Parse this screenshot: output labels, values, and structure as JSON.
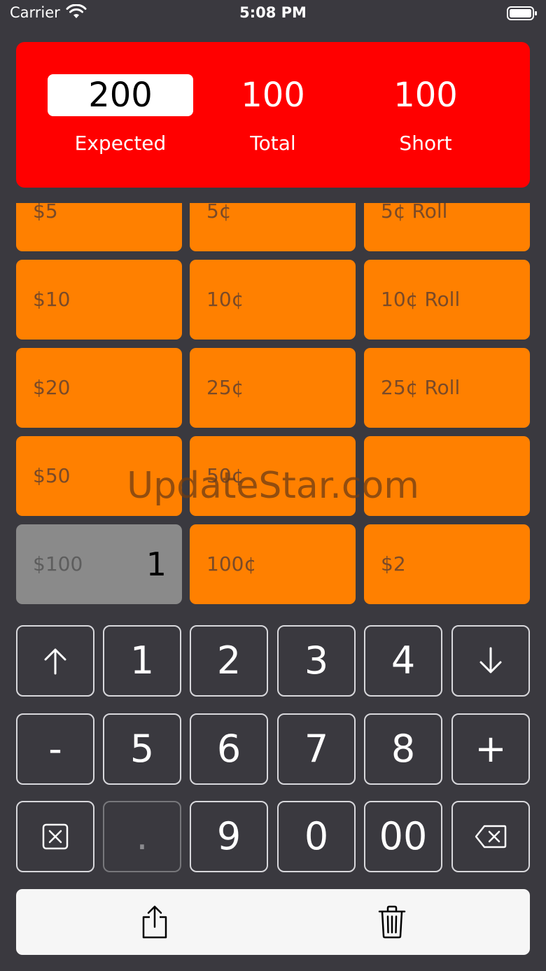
{
  "status_bar": {
    "carrier": "Carrier",
    "time": "5:08 PM"
  },
  "summary": {
    "expected_value": "200",
    "expected_label": "Expected",
    "total_value": "100",
    "total_label": "Total",
    "short_value": "100",
    "short_label": "Short"
  },
  "denominations": {
    "row1": [
      "$5",
      "5¢",
      "5¢ Roll"
    ],
    "row2": [
      "$10",
      "10¢",
      "10¢ Roll"
    ],
    "row3": [
      "$20",
      "25¢",
      "25¢ Roll"
    ],
    "row4": [
      "$50",
      "50¢",
      ""
    ],
    "row5": [
      "$100",
      "100¢",
      "$2"
    ],
    "selected_count": "1"
  },
  "keypad": {
    "row1": [
      "↑",
      "1",
      "2",
      "3",
      "4",
      "↓"
    ],
    "row2": [
      "-",
      "5",
      "6",
      "7",
      "8",
      "+"
    ],
    "row3": [
      "clear",
      ".",
      "9",
      "0",
      "00",
      "backspace"
    ]
  },
  "watermark": "UpdateStar.com",
  "colors": {
    "summary_bg": "#ff0000",
    "denom_bg": "#ff8000",
    "selected_bg": "#8a8a8a",
    "app_bg": "#3a393f"
  }
}
